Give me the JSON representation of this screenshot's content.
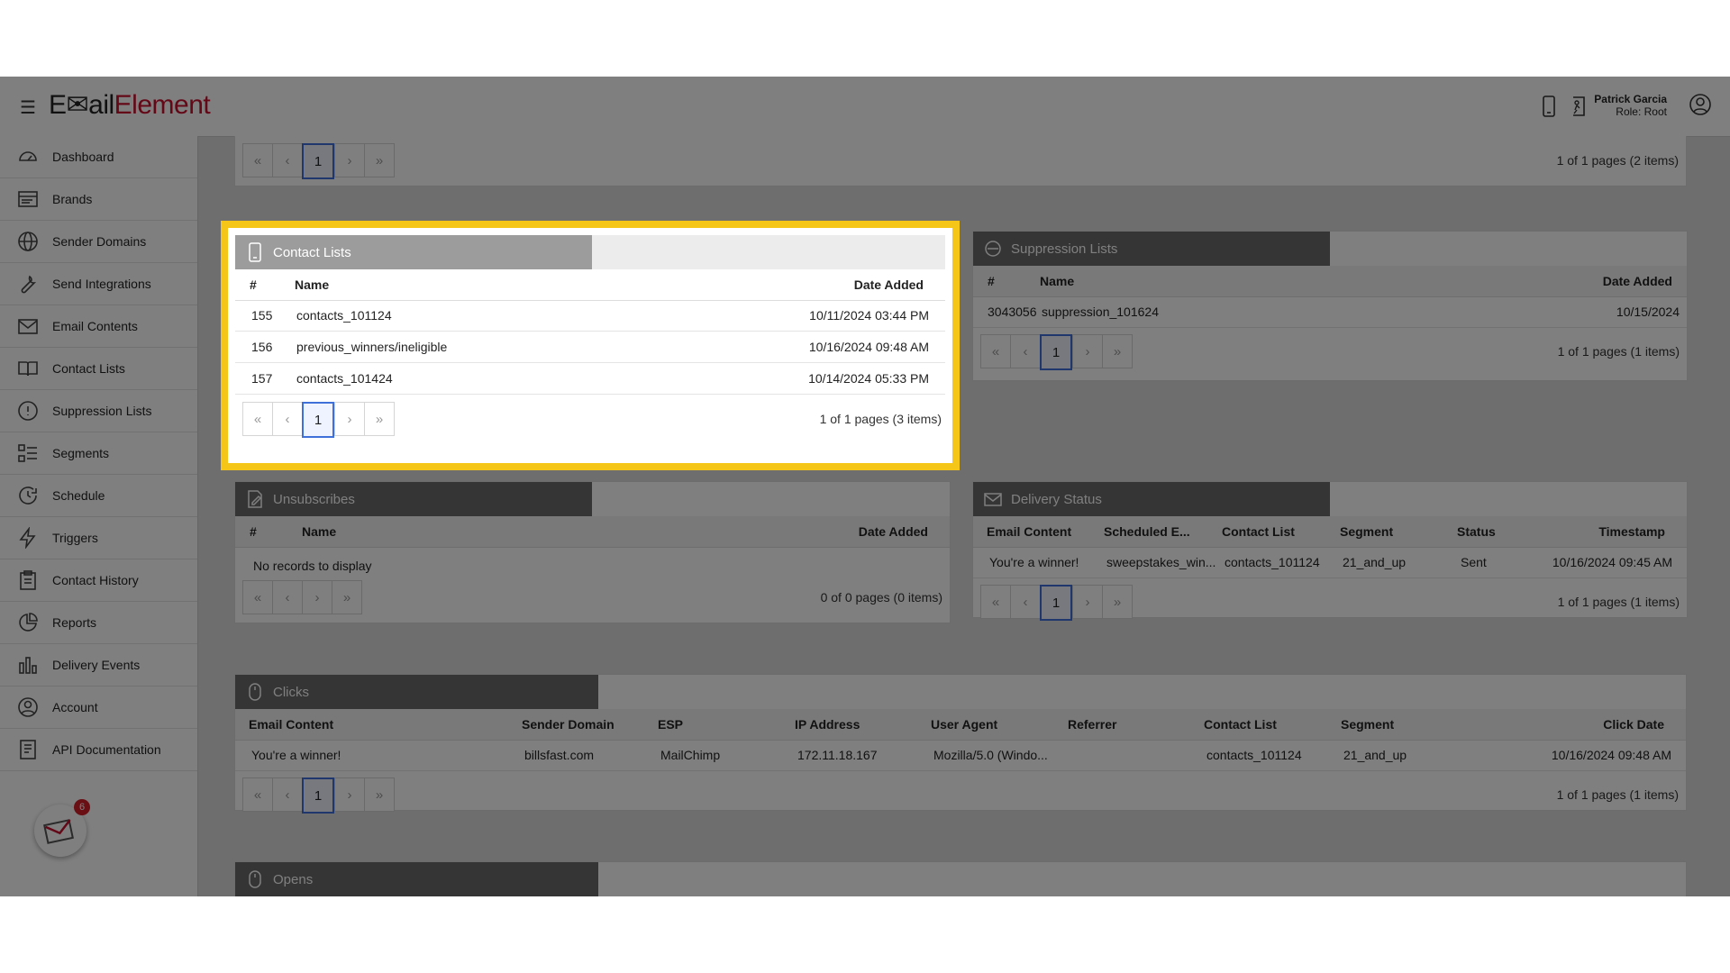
{
  "app": {
    "logo_part1": "E",
    "logo_part2": "ail",
    "logo_part3": "Element",
    "user_name": "Patrick Garcia",
    "user_role": "Role: Root"
  },
  "sidebar": {
    "items": [
      {
        "label": "Dashboard",
        "icon": "dashboard-icon"
      },
      {
        "label": "Brands",
        "icon": "brands-icon"
      },
      {
        "label": "Sender Domains",
        "icon": "globe-icon"
      },
      {
        "label": "Send Integrations",
        "icon": "wrench-icon"
      },
      {
        "label": "Email Contents",
        "icon": "envelope-icon"
      },
      {
        "label": "Contact Lists",
        "icon": "book-icon"
      },
      {
        "label": "Suppression Lists",
        "icon": "alert-icon"
      },
      {
        "label": "Segments",
        "icon": "segments-icon"
      },
      {
        "label": "Schedule",
        "icon": "clock-icon"
      },
      {
        "label": "Triggers",
        "icon": "lightning-icon"
      },
      {
        "label": "Contact History",
        "icon": "clipboard-icon"
      },
      {
        "label": "Reports",
        "icon": "pie-icon"
      },
      {
        "label": "Delivery Events",
        "icon": "bar-chart-icon"
      },
      {
        "label": "Account",
        "icon": "user-icon"
      },
      {
        "label": "API Documentation",
        "icon": "document-icon"
      }
    ],
    "notification_count": "6"
  },
  "pager_symbols": {
    "first": "«",
    "prev": "‹",
    "next": "›",
    "last": "»"
  },
  "top_pager": {
    "current": "1",
    "info": "1 of 1 pages (2 items)"
  },
  "contact_lists": {
    "title": "Contact Lists",
    "headers": {
      "id": "#",
      "name": "Name",
      "date": "Date Added"
    },
    "rows": [
      {
        "id": "155",
        "name": "contacts_101124",
        "date": "10/11/2024 03:44 PM"
      },
      {
        "id": "156",
        "name": "previous_winners/ineligible",
        "date": "10/16/2024 09:48 AM"
      },
      {
        "id": "157",
        "name": "contacts_101424",
        "date": "10/14/2024 05:33 PM"
      }
    ],
    "pager": {
      "current": "1",
      "info": "1 of 1 pages (3 items)"
    }
  },
  "suppression_lists": {
    "title": "Suppression Lists",
    "headers": {
      "id": "#",
      "name": "Name",
      "date": "Date Added"
    },
    "rows": [
      {
        "id": "3043056",
        "name": "suppression_101624",
        "date": "10/15/2024"
      }
    ],
    "pager": {
      "current": "1",
      "info": "1 of 1 pages (1 items)"
    }
  },
  "unsubscribes": {
    "title": "Unsubscribes",
    "headers": {
      "id": "#",
      "name": "Name",
      "date": "Date Added"
    },
    "empty": "No records to display",
    "pager": {
      "info": "0 of 0 pages (0 items)"
    }
  },
  "delivery_status": {
    "title": "Delivery Status",
    "headers": {
      "email": "Email Content",
      "sched": "Scheduled E...",
      "list": "Contact List",
      "segment": "Segment",
      "status": "Status",
      "ts": "Timestamp"
    },
    "rows": [
      {
        "email": "You're a winner!",
        "sched": "sweepstakes_win...",
        "list": "contacts_101124",
        "segment": "21_and_up",
        "status": "Sent",
        "ts": "10/16/2024 09:45 AM"
      }
    ],
    "pager": {
      "current": "1",
      "info": "1 of 1 pages (1 items)"
    }
  },
  "clicks": {
    "title": "Clicks",
    "headers": {
      "email": "Email Content",
      "domain": "Sender Domain",
      "esp": "ESP",
      "ip": "IP Address",
      "ua": "User Agent",
      "ref": "Referrer",
      "list": "Contact List",
      "segment": "Segment",
      "date": "Click Date"
    },
    "rows": [
      {
        "email": "You're a winner!",
        "domain": "billsfast.com",
        "esp": "MailChimp",
        "ip": "172.11.18.167",
        "ua": "Mozilla/5.0 (Windo...",
        "ref": "",
        "list": "contacts_101124",
        "segment": "21_and_up",
        "date": "10/16/2024 09:48 AM"
      }
    ],
    "pager": {
      "current": "1",
      "info": "1 of 1 pages (1 items)"
    }
  },
  "opens": {
    "title": "Opens"
  },
  "colors": {
    "highlight": "#f5c518",
    "brand_red": "#c8102e",
    "pager_active": "#3f6fd8"
  }
}
